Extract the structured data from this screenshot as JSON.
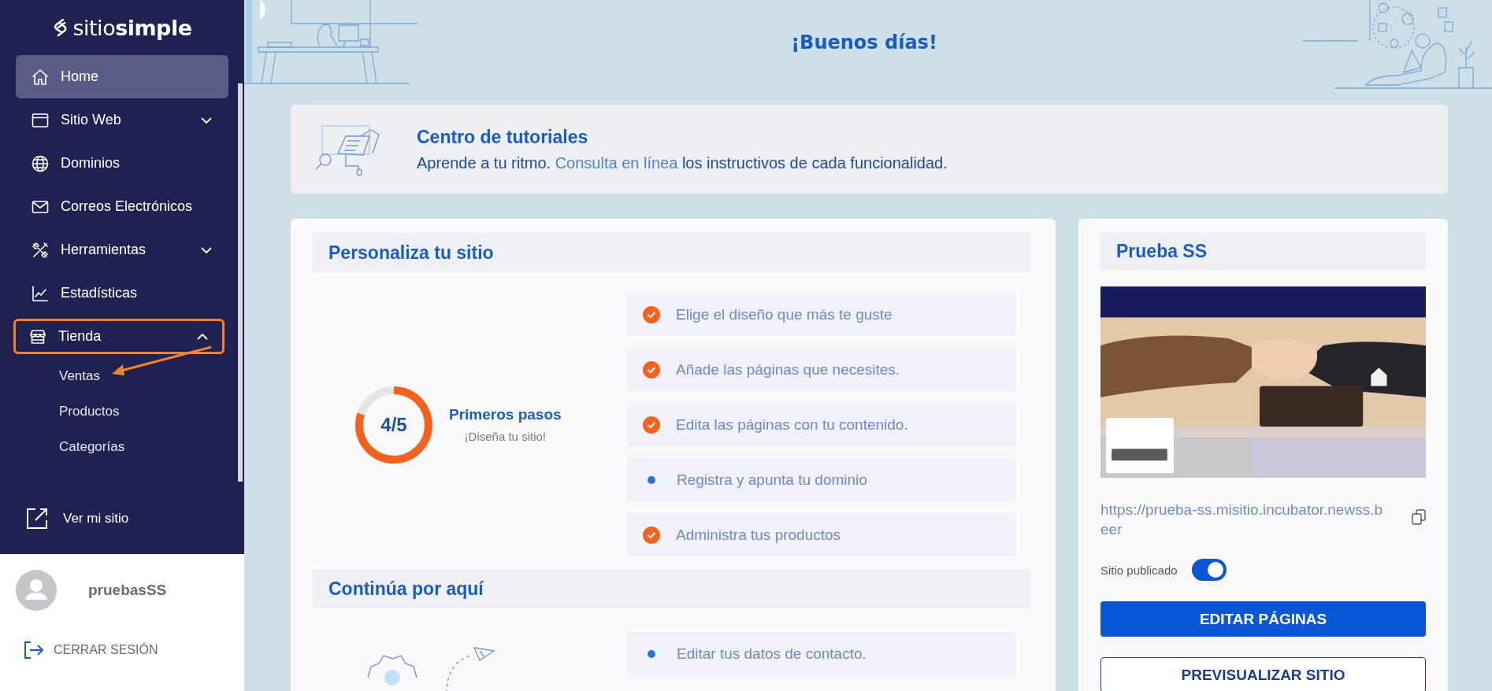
{
  "sidebar": {
    "logo": {
      "light": "sitio",
      "bold": "simple"
    },
    "items": [
      {
        "label": "Home",
        "selected": true
      },
      {
        "label": "Sitio Web",
        "selected": false,
        "expanded": false
      },
      {
        "label": "Dominios",
        "selected": false
      },
      {
        "label": "Correos Electrónicos",
        "selected": false
      },
      {
        "label": "Herramientas",
        "selected": false,
        "expanded": false
      },
      {
        "label": "Estadísticas",
        "selected": false
      },
      {
        "label": "Tienda",
        "selected": false,
        "expanded": true,
        "highlighted": true,
        "children": [
          {
            "label": "Ventas"
          },
          {
            "label": "Productos"
          },
          {
            "label": "Categorías"
          }
        ]
      }
    ],
    "view_site": "Ver mi sitio",
    "user": {
      "name": "pruebasSS"
    },
    "logout": "CERRAR SESIÓN"
  },
  "greeting": "¡Buenos días!",
  "tutorials": {
    "title": "Centro de tutoriales",
    "before": "Aprende a tu ritmo.",
    "link": "Consulta en línea",
    "after": "los instructivos de cada funcionalidad."
  },
  "personalize": {
    "title": "Personaliza tu sitio",
    "progress": {
      "value": "4/5",
      "level": 0.8,
      "title": "Primeros pasos",
      "subtitle": "¡Diseña tu sitio!"
    },
    "steps": [
      {
        "label": "Elige el diseño que más te guste",
        "done": true
      },
      {
        "label": "Añade las páginas que necesites.",
        "done": true
      },
      {
        "label": "Edita las páginas con tu contenido.",
        "done": true
      },
      {
        "label": "Registra y apunta tu dominio",
        "done": false
      },
      {
        "label": "Administra tus productos",
        "done": true
      }
    ]
  },
  "continue": {
    "title": "Continúa por aquí",
    "steps": [
      {
        "label": "Editar tus datos de contacto.",
        "done": false
      }
    ]
  },
  "site": {
    "name": "Prueba SS",
    "url": "https://prueba-ss.misitio.incubator.newss.beer",
    "published_label": "Sitio publicado",
    "published": true,
    "buttons": [
      {
        "label": "EDITAR PÁGINAS",
        "kind": "primary"
      },
      {
        "label": "PREVISUALIZAR SITIO",
        "kind": "outline"
      }
    ]
  }
}
